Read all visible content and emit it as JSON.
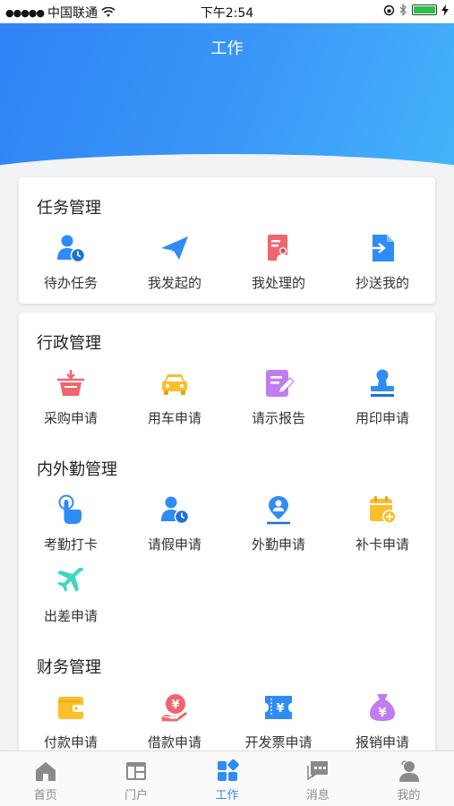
{
  "status_bar": {
    "carrier": "中国联通",
    "time": "下午2:54"
  },
  "header": {
    "title": "工作"
  },
  "sections": [
    {
      "title": "任务管理",
      "items": [
        {
          "label": "待办任务",
          "icon": "user-clock-icon"
        },
        {
          "label": "我发起的",
          "icon": "paper-plane-icon"
        },
        {
          "label": "我处理的",
          "icon": "document-user-icon"
        },
        {
          "label": "抄送我的",
          "icon": "file-forward-icon"
        }
      ]
    },
    {
      "title": "行政管理",
      "items": [
        {
          "label": "采购申请",
          "icon": "shopping-basket-icon"
        },
        {
          "label": "用车申请",
          "icon": "car-icon"
        },
        {
          "label": "请示报告",
          "icon": "edit-document-icon"
        },
        {
          "label": "用印申请",
          "icon": "stamp-icon"
        }
      ]
    },
    {
      "title": "内外勤管理",
      "items": [
        {
          "label": "考勤打卡",
          "icon": "tap-hand-icon"
        },
        {
          "label": "请假申请",
          "icon": "user-clock-icon"
        },
        {
          "label": "外勤申请",
          "icon": "location-user-icon"
        },
        {
          "label": "补卡申请",
          "icon": "calendar-add-icon"
        },
        {
          "label": "出差申请",
          "icon": "airplane-icon"
        }
      ]
    },
    {
      "title": "财务管理",
      "items": [
        {
          "label": "付款申请",
          "icon": "wallet-icon"
        },
        {
          "label": "借款申请",
          "icon": "yuan-hand-icon"
        },
        {
          "label": "开发票申请",
          "icon": "invoice-icon"
        },
        {
          "label": "报销申请",
          "icon": "money-bag-icon"
        }
      ]
    }
  ],
  "tabs": [
    {
      "label": "首页",
      "icon": "home-icon",
      "active": false
    },
    {
      "label": "门户",
      "icon": "portal-icon",
      "active": false
    },
    {
      "label": "工作",
      "icon": "work-grid-icon",
      "active": true
    },
    {
      "label": "消息",
      "icon": "message-icon",
      "active": false
    },
    {
      "label": "我的",
      "icon": "profile-icon",
      "active": false
    }
  ],
  "colors": {
    "accent": "#2f8cf6",
    "header_start": "#2f82f5",
    "header_end": "#45b3fb",
    "icon_blue": "#2f8cf6",
    "icon_red": "#f0656f",
    "icon_yellow": "#fbbf2a",
    "icon_purple": "#c27bf0",
    "icon_teal": "#3fd6c4"
  }
}
